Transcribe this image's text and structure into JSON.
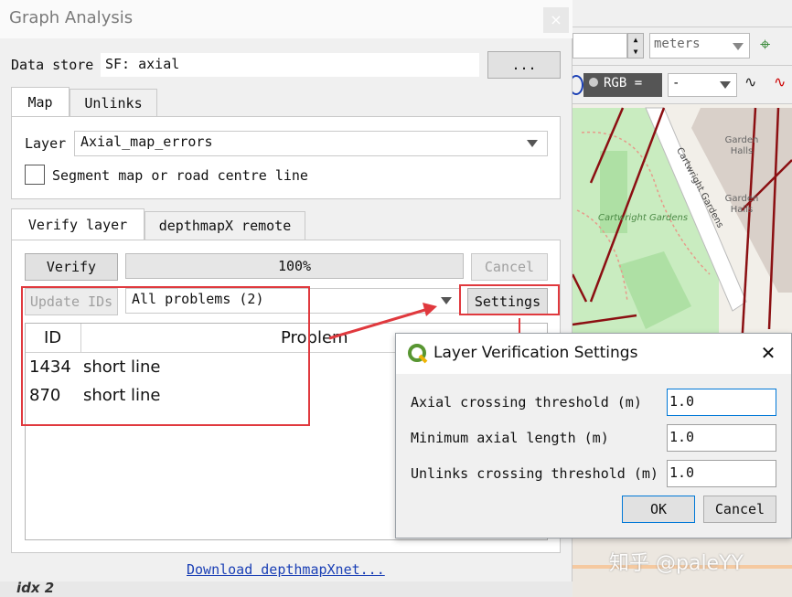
{
  "dialog": {
    "title": "Graph Analysis",
    "close_symbol": "×",
    "data_store_label": "Data store",
    "data_store_value": "SF: axial",
    "data_store_button": "...",
    "top_tabs": [
      {
        "label": "Map"
      },
      {
        "label": "Unlinks"
      }
    ],
    "layer_label": "Layer",
    "layer_value": "Axial_map_errors",
    "segment_checkbox_label": "Segment map or road centre line",
    "bottom_tabs": [
      {
        "label": "Verify layer"
      },
      {
        "label": "depthmapX remote"
      }
    ],
    "verify_button": "Verify",
    "progress_text": "100%",
    "progress_value": 1.0,
    "cancel_button": "Cancel",
    "update_ids_button": "Update IDs",
    "problems_combo": "All problems (2)",
    "settings_button": "Settings",
    "table": {
      "headers": [
        "ID",
        "Problem"
      ],
      "rows": [
        {
          "id": "1434",
          "problem": "short line"
        },
        {
          "id": "870",
          "problem": "short line"
        }
      ]
    },
    "download_link": "Download depthmapXnet..."
  },
  "settings_dialog": {
    "title": "Layer Verification Settings",
    "close_symbol": "✕",
    "fields": [
      {
        "label": "Axial crossing threshold (m)",
        "value": "1.0"
      },
      {
        "label": "Minimum axial length (m)",
        "value": "1.0"
      },
      {
        "label": "Unlinks crossing threshold (m)",
        "value": "1.0"
      }
    ],
    "ok_button": "OK",
    "cancel_button": "Cancel"
  },
  "qgis_background": {
    "units_combo": "meters",
    "rgb_label": "RGB =",
    "rgb_value": "-",
    "map_labels": [
      "Garden Halls",
      "Garden Halls",
      "Cartwright Gardens",
      "Cartwright Gardens"
    ],
    "watermark": "知乎 @paleYY",
    "bottom_fragment": "idx 2"
  },
  "colors": {
    "annotation_red": "#e0393e",
    "link_blue": "#1a3fb5",
    "map_road_red": "#8b0f12",
    "map_green": "#c9ecc0"
  }
}
